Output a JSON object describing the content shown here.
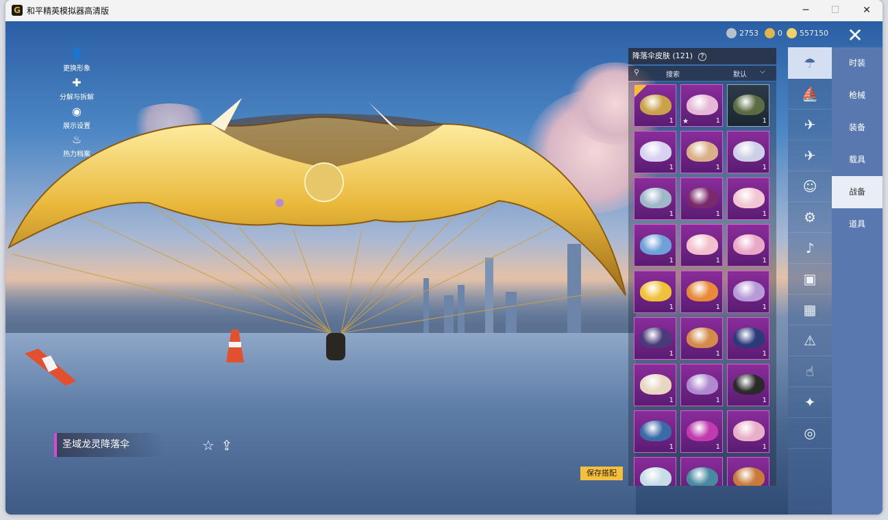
{
  "window": {
    "title": "和平精英模拟器高清版",
    "minimize": "─",
    "maximize": "☐",
    "close": "✕"
  },
  "side_menu": [
    {
      "label": "更换形象",
      "icon": "avatar-icon"
    },
    {
      "label": "分解与拆解",
      "icon": "puzzle-icon"
    },
    {
      "label": "展示设置",
      "icon": "eye-icon"
    },
    {
      "label": "热力档案",
      "icon": "flame-icon"
    }
  ],
  "currency": [
    {
      "value": "2753",
      "color": "#b9c2cc"
    },
    {
      "value": "0",
      "color": "#e0b54a"
    },
    {
      "value": "557150",
      "color": "#f1d26a"
    }
  ],
  "item": {
    "name": "圣域龙灵降落伞"
  },
  "save_label": "保存搭配",
  "panel": {
    "title": "降落伞皮肤 (121)",
    "help": "?",
    "search_placeholder": "搜索",
    "sort_value": "默认"
  },
  "grid": {
    "cells": [
      {
        "qty": "1",
        "color": "#c9a24a"
      },
      {
        "qty": "1",
        "color": "#e6b8d8"
      },
      {
        "qty": "1",
        "color": "#5b6b43"
      },
      {
        "qty": "1",
        "color": "#d8d2f0"
      },
      {
        "qty": "1",
        "color": "#d9b08a"
      },
      {
        "qty": "1",
        "color": "#cdd0e6"
      },
      {
        "qty": "1",
        "color": "#9fb7c9"
      },
      {
        "qty": "1",
        "color": "#7a2a6a"
      },
      {
        "qty": "1",
        "color": "#f0c6d2"
      },
      {
        "qty": "1",
        "color": "#6fa0d8"
      },
      {
        "qty": "1",
        "color": "#f2c0cc"
      },
      {
        "qty": "1",
        "color": "#e9a8c8"
      },
      {
        "qty": "1",
        "color": "#f0c23a"
      },
      {
        "qty": "1",
        "color": "#e88a3a"
      },
      {
        "qty": "1",
        "color": "#b79ad8"
      },
      {
        "qty": "1",
        "color": "#4a3a7a"
      },
      {
        "qty": "1",
        "color": "#d48a4a"
      },
      {
        "qty": "1",
        "color": "#2a3a7a"
      },
      {
        "qty": "1",
        "color": "#e8d6c0"
      },
      {
        "qty": "1",
        "color": "#b08ad0"
      },
      {
        "qty": "1",
        "color": "#2a2a2a"
      },
      {
        "qty": "1",
        "color": "#3a6aa8"
      },
      {
        "qty": "1",
        "color": "#c03ab0"
      },
      {
        "qty": "1",
        "color": "#e8b0c8"
      },
      {
        "qty": "",
        "color": "#c8dce8"
      },
      {
        "qty": "",
        "color": "#4a8aa0"
      },
      {
        "qty": "",
        "color": "#c87a3a"
      }
    ]
  },
  "categories": [
    {
      "icon": "parachute-icon"
    },
    {
      "icon": "boat-icon"
    },
    {
      "icon": "drone-icon"
    },
    {
      "icon": "plane-icon"
    },
    {
      "icon": "emote-icon"
    },
    {
      "icon": "robot-icon"
    },
    {
      "icon": "speaker-icon"
    },
    {
      "icon": "pet-icon"
    },
    {
      "icon": "photo-icon"
    },
    {
      "icon": "extinguisher-icon"
    },
    {
      "icon": "hand-icon"
    },
    {
      "icon": "wand-icon"
    },
    {
      "icon": "ufo-icon"
    }
  ],
  "tabs": [
    {
      "label": "时装"
    },
    {
      "label": "枪械"
    },
    {
      "label": "装备"
    },
    {
      "label": "载具"
    },
    {
      "label": "战备"
    },
    {
      "label": "道具"
    }
  ]
}
